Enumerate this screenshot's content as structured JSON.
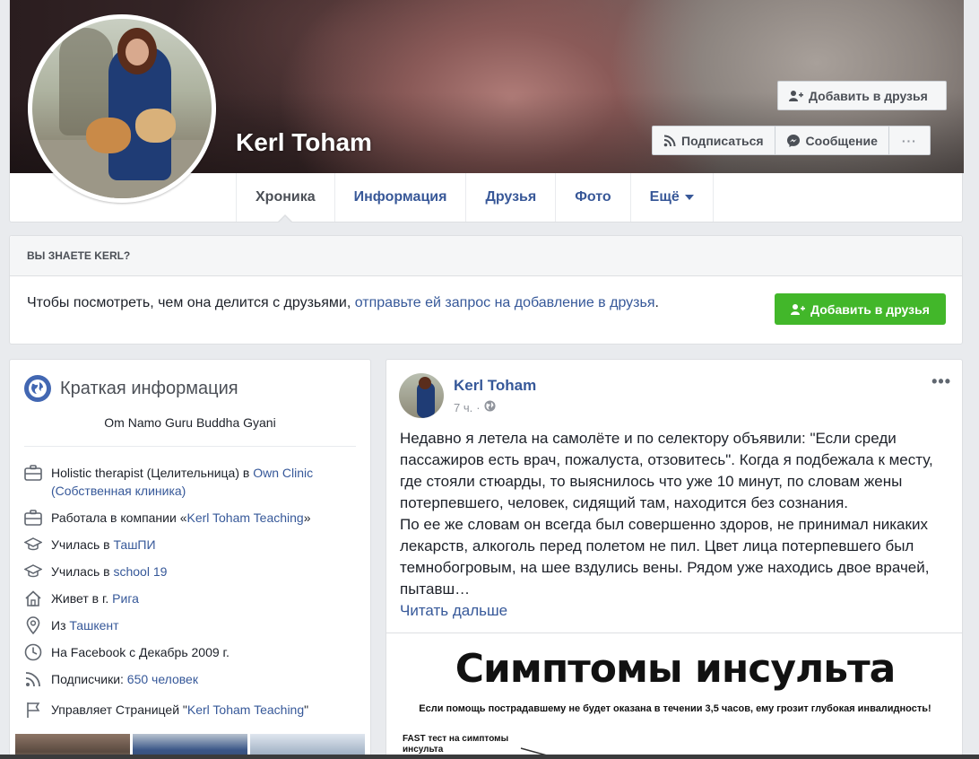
{
  "profile": {
    "name": "Kerl Toham"
  },
  "header_buttons": {
    "add_friend": "Добавить в друзья",
    "subscribe": "Подписаться",
    "message": "Сообщение",
    "more": "···"
  },
  "tabs": [
    {
      "label": "Хроника",
      "active": true
    },
    {
      "label": "Информация",
      "active": false
    },
    {
      "label": "Друзья",
      "active": false
    },
    {
      "label": "Фото",
      "active": false
    },
    {
      "label": "Ещё",
      "active": false
    }
  ],
  "know_box": {
    "heading": "ВЫ ЗНАЕТЕ KERL?",
    "text": "Чтобы посмотреть, чем она делится с друзьями, ",
    "link": "отправьте ей запрос на добавление в друзья",
    "text_end": ".",
    "button": "Добавить в друзья"
  },
  "intro": {
    "title": "Краткая информация",
    "bio": "Om Namo Guru Buddha Gyani",
    "items": [
      {
        "icon": "briefcase-icon",
        "prefix": "Holistic therapist (Целительница) в ",
        "link": "Own Clinic (Собственная клиника)",
        "suffix": ""
      },
      {
        "icon": "briefcase-icon",
        "prefix": "Работала в компании «",
        "link": "Kerl Toham Teaching",
        "suffix": "»"
      },
      {
        "icon": "graduation-cap-icon",
        "prefix": "Училась в ",
        "link": "ТашПИ",
        "suffix": ""
      },
      {
        "icon": "graduation-cap-icon",
        "prefix": "Училась в ",
        "link": "school 19",
        "suffix": ""
      },
      {
        "icon": "home-icon",
        "prefix": "Живет в г. ",
        "link": "Рига",
        "suffix": ""
      },
      {
        "icon": "location-pin-icon",
        "prefix": "Из ",
        "link": "Ташкент",
        "suffix": ""
      },
      {
        "icon": "clock-icon",
        "prefix": "На Facebook с Декабрь 2009 г.",
        "link": "",
        "suffix": ""
      },
      {
        "icon": "rss-icon",
        "prefix": "Подписчики: ",
        "link": "650 человек",
        "suffix": ""
      },
      {
        "icon": "flag-icon",
        "prefix": "Управляет Страницей \"",
        "link": "Kerl Toham Teaching",
        "suffix": "\""
      }
    ]
  },
  "post": {
    "author": "Kerl Toham",
    "time": "7 ч.",
    "separator": "·",
    "menu": "•••",
    "text": "Недавно я летела на самолёте и по селектору объявили: \"Если среди пассажиров есть врач, пожалуста, отзовитесь\". Когда я подбежала к месту, где стояли стюарды, то выяснилось что уже 10 минут, по словам жены потерпевшего, человек, сидящий там, находится без сознания.\nПо ее же словам он всегда был совершенно здоров, не принимал никаких лекарств, алкоголь перед полетом не пил. Цвет лица потерпевшего был темнобогровым, на шее вздулись вены. Рядом уже находись двое врачей, пытавш…",
    "read_more": "Читать дальше",
    "image": {
      "title": "Симптомы инсульта",
      "subtitle": "Если помощь пострадавшему не будет оказана в течении 3,5 часов, ему грозит глубокая инвалидность!",
      "fast_label": "FAST тест на симптомы инсульта"
    }
  },
  "colors": {
    "link": "#365899",
    "green": "#42b72a",
    "background": "#e9ebee"
  }
}
